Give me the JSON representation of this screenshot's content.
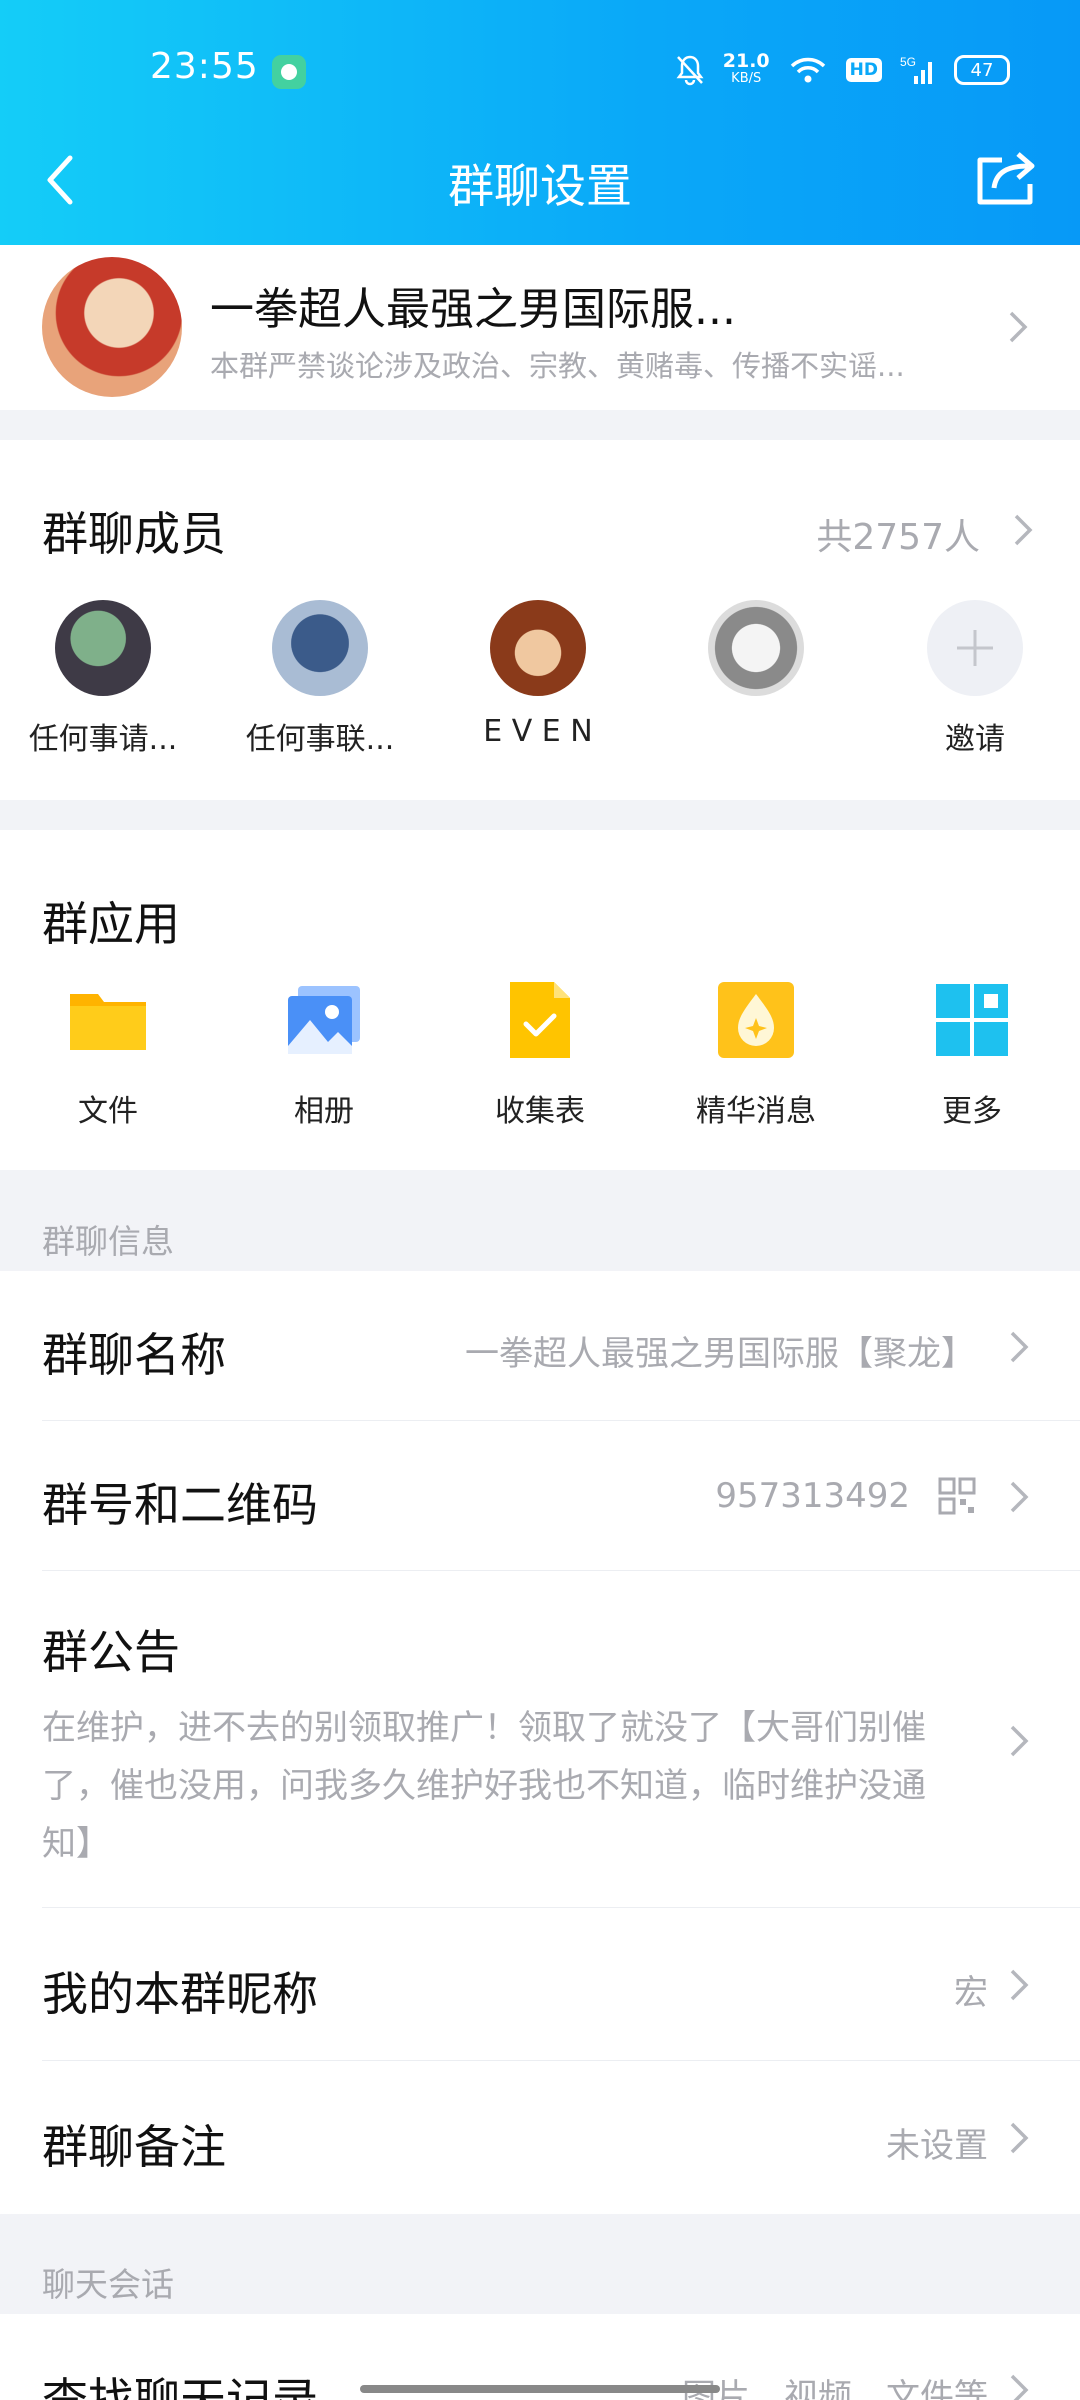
{
  "status_bar": {
    "time": "23:55",
    "net_speed": "21.0",
    "net_unit": "KB/S",
    "hd": "HD",
    "signal": "5G",
    "battery": "47"
  },
  "header": {
    "title": "群聊设置"
  },
  "group": {
    "name": "一拳超人最强之男国际服...",
    "description": "本群严禁谈论涉及政治、宗教、黄赌毒、传播不实谣..."
  },
  "members": {
    "title": "群聊成员",
    "count": "共2757人",
    "list": [
      {
        "name": "任何事请..."
      },
      {
        "name": "任何事联..."
      },
      {
        "name": "E V E N"
      },
      {
        "name": ""
      }
    ],
    "invite_label": "邀请"
  },
  "apps": {
    "title": "群应用",
    "items": [
      {
        "label": "文件",
        "icon": "folder-icon"
      },
      {
        "label": "相册",
        "icon": "photo-album-icon"
      },
      {
        "label": "收集表",
        "icon": "form-check-icon"
      },
      {
        "label": "精华消息",
        "icon": "essence-message-icon"
      },
      {
        "label": "更多",
        "icon": "grid-more-icon"
      }
    ]
  },
  "info": {
    "section_label": "群聊信息",
    "name_label": "群聊名称",
    "name_value": "一拳超人最强之男国际服【聚龙】",
    "number_label": "群号和二维码",
    "number_value": "957313492",
    "notice_label": "群公告",
    "notice_text": "在维护，进不去的别领取推广！领取了就没了【大哥们别催了，催也没用，问我多久维护好我也不知道，临时维护没通知】",
    "nickname_label": "我的本群昵称",
    "nickname_value": "宏",
    "remark_label": "群聊备注",
    "remark_value": "未设置"
  },
  "chat": {
    "section_label": "聊天会话",
    "search_label": "查找聊天记录",
    "search_value": "图片、视频、文件等"
  },
  "colors": {
    "accent": "#0aa8f8",
    "secondary_text": "#a9aab0",
    "background": "#f2f3f7"
  }
}
